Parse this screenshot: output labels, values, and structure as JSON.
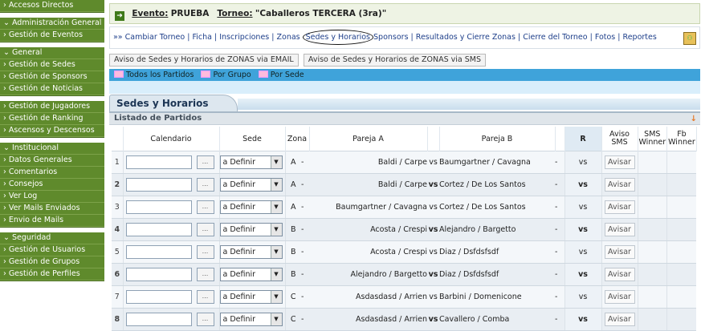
{
  "sidebar": {
    "groups": [
      {
        "items": [
          {
            "label": "› Accesos Directos"
          }
        ]
      },
      {
        "items": [
          {
            "label": "⌄ Administración General",
            "head": true
          },
          {
            "label": "› Gestión de Eventos"
          }
        ]
      },
      {
        "items": [
          {
            "label": "⌄ General",
            "head": true
          },
          {
            "label": "› Gestión de Sedes"
          },
          {
            "label": "› Gestión de Sponsors"
          },
          {
            "label": "› Gestión de Noticias"
          }
        ]
      },
      {
        "items": [
          {
            "label": "› Gestión de Jugadores"
          },
          {
            "label": "› Gestión de Ranking"
          },
          {
            "label": "› Ascensos y Descensos"
          }
        ]
      },
      {
        "items": [
          {
            "label": "⌄ Institucional",
            "head": true
          },
          {
            "label": "› Datos Generales"
          },
          {
            "label": "› Comentarios"
          },
          {
            "label": "› Consejos"
          },
          {
            "label": "› Ver Log"
          },
          {
            "label": "› Ver Mails Enviados"
          },
          {
            "label": "› Envio de Mails"
          }
        ]
      },
      {
        "items": [
          {
            "label": "⌄ Seguridad",
            "head": true
          },
          {
            "label": "› Gestión de Usuarios"
          },
          {
            "label": "› Gestión de Grupos"
          },
          {
            "label": "› Gestión de Perfiles"
          }
        ]
      }
    ]
  },
  "event": {
    "evento_label": "Evento:",
    "evento_value": "PRUEBA",
    "torneo_label": "Torneo:",
    "torneo_value": "\"Caballeros TERCERA (3ra)\""
  },
  "links": {
    "prefix": "»» ",
    "items": [
      "Cambiar Torneo",
      "Ficha",
      "Inscripciones",
      "Zonas",
      "Sedes y Horarios",
      "Sponsors",
      "Resultados y Cierre Zonas",
      "Cierre del Torneo",
      "Fotos",
      "Reportes"
    ],
    "highlighted": "Sedes y Horarios"
  },
  "sms_buttons": [
    "Aviso de Sedes y Horarios de ZONAS via EMAIL",
    "Aviso de Sedes y Horarios de ZONAS via SMS"
  ],
  "filters": [
    "Todos los Partidos",
    "Por Grupo",
    "Por Sede"
  ],
  "section_title": "Sedes y Horarios",
  "list_title": "Listado de Partidos",
  "columns": {
    "calendario": "Calendario",
    "sede": "Sede",
    "zona": "Zona",
    "pareja_a": "Pareja A",
    "pareja_b": "Pareja B",
    "r": "R",
    "aviso_sms": "Aviso SMS",
    "sms_winner": "SMS Winner",
    "fb_winner": "Fb Winner"
  },
  "rows": [
    {
      "n": "1",
      "sede": "a Definir",
      "zona": "A",
      "pa": "Baldi / Carpe",
      "vs": "vs",
      "pb": "Baumgartner / Cavagna",
      "r": "vs",
      "avisar": "Avisar"
    },
    {
      "n": "2",
      "sede": "a Definir",
      "zona": "A",
      "pa": "Baldi / Carpe",
      "vs": "vs",
      "pb": "Cortez / De Los Santos",
      "r": "vs",
      "avisar": "Avisar"
    },
    {
      "n": "3",
      "sede": "a Definir",
      "zona": "A",
      "pa": "Baumgartner / Cavagna",
      "vs": "vs",
      "pb": "Cortez / De Los Santos",
      "r": "vs",
      "avisar": "Avisar"
    },
    {
      "n": "4",
      "sede": "a Definir",
      "zona": "B",
      "pa": "Acosta / Crespi",
      "vs": "vs",
      "pb": "Alejandro / Bargetto",
      "r": "vs",
      "avisar": "Avisar"
    },
    {
      "n": "5",
      "sede": "a Definir",
      "zona": "B",
      "pa": "Acosta / Crespi",
      "vs": "vs",
      "pb": "Diaz / Dsfdsfsdf",
      "r": "vs",
      "avisar": "Avisar"
    },
    {
      "n": "6",
      "sede": "a Definir",
      "zona": "B",
      "pa": "Alejandro / Bargetto",
      "vs": "vs",
      "pb": "Diaz / Dsfdsfsdf",
      "r": "vs",
      "avisar": "Avisar"
    },
    {
      "n": "7",
      "sede": "a Definir",
      "zona": "C",
      "pa": "Asdasdasd / Arrien",
      "vs": "vs",
      "pb": "Barbini / Domenicone",
      "r": "vs",
      "avisar": "Avisar"
    },
    {
      "n": "8",
      "sede": "a Definir",
      "zona": "C",
      "pa": "Asdasdasd / Arrien",
      "vs": "vs",
      "pb": "Cavallero / Comba",
      "r": "vs",
      "avisar": "Avisar"
    }
  ],
  "colors": {
    "sidebar_green": "#5f8a2c",
    "filter_blue": "#3fa3da",
    "link_blue": "#1e3f8a"
  }
}
